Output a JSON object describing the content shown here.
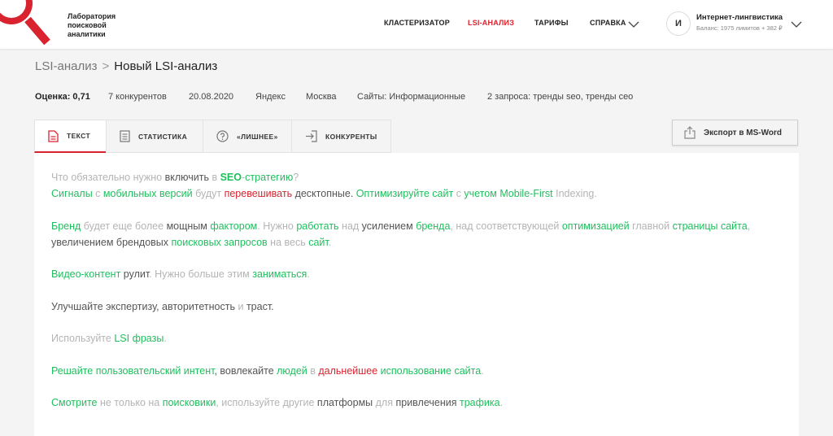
{
  "header": {
    "logo_line1": "Лаборатория",
    "logo_line2": "поисковой",
    "logo_line3": "аналитики",
    "nav": {
      "clusterizer": "КЛАСТЕРИЗАТОР",
      "lsi": "LSI-АНАЛИЗ",
      "tariffs": "ТАРИФЫ",
      "help": "СПРАВКА"
    },
    "user": {
      "initial": "И",
      "name": "Интернет-лингвистика",
      "balance": "Баланс: 1975 лимитов + 382 ₽"
    }
  },
  "breadcrumb": {
    "parent": "LSI-анализ",
    "separator": ">",
    "current": "Новый LSI-анализ"
  },
  "meta": {
    "score_label": "Оценка: 0,71",
    "competitors": "7 конкурентов",
    "date": "20.08.2020",
    "engine": "Яндекс",
    "city": "Москва",
    "sites": "Сайты: Информационные",
    "queries": "2 запроса: тренды seo, тренды сео"
  },
  "tabs": {
    "text": "ТЕКСТ",
    "stats": "СТАТИСТИКА",
    "extra": "«ЛИШНЕЕ»",
    "competitors": "КОНКУРЕНТЫ"
  },
  "export_label": "Экспорт в MS-Word",
  "colors": {
    "accent": "#d9232e",
    "green": "#1fbf5e",
    "gray": "#b4b4b4"
  },
  "text": {
    "p1": [
      {
        "t": "Что обязательно нужно ",
        "c": "gray"
      },
      {
        "t": "включить",
        "c": "dark"
      },
      {
        "t": " в ",
        "c": "gray"
      },
      {
        "t": "SEO",
        "c": "green",
        "b": true
      },
      {
        "t": "-",
        "c": "gray"
      },
      {
        "t": "стратегию",
        "c": "green"
      },
      {
        "t": "?",
        "c": "gray"
      }
    ],
    "p2": [
      {
        "t": "Сигналы",
        "c": "green"
      },
      {
        "t": " с ",
        "c": "gray"
      },
      {
        "t": "мобильных версий",
        "c": "green"
      },
      {
        "t": " будут ",
        "c": "gray"
      },
      {
        "t": "перевешивать",
        "c": "red"
      },
      {
        "t": " десктопные. ",
        "c": "dark"
      },
      {
        "t": "Оптимизируйте сайт",
        "c": "green"
      },
      {
        "t": " с ",
        "c": "gray"
      },
      {
        "t": "учетом",
        "c": "green"
      },
      {
        "t": " Mobile-First",
        "c": "green"
      },
      {
        "t": " Indexing.",
        "c": "gray"
      }
    ],
    "p3a": [
      {
        "t": "Бренд",
        "c": "green"
      },
      {
        "t": " будет еще более ",
        "c": "gray"
      },
      {
        "t": "мощным",
        "c": "dark"
      },
      {
        "t": " ",
        "c": "gray"
      },
      {
        "t": "фактором",
        "c": "green"
      },
      {
        "t": ". Нужно ",
        "c": "gray"
      },
      {
        "t": "работать",
        "c": "green"
      },
      {
        "t": " над ",
        "c": "gray"
      },
      {
        "t": "усилением",
        "c": "dark"
      },
      {
        "t": " ",
        "c": "gray"
      },
      {
        "t": "бренда",
        "c": "green"
      },
      {
        "t": ", над соответствующей ",
        "c": "gray"
      },
      {
        "t": "оптимизацией",
        "c": "green"
      },
      {
        "t": " главной ",
        "c": "gray"
      },
      {
        "t": "страницы сайта",
        "c": "green"
      },
      {
        "t": ",",
        "c": "gray"
      }
    ],
    "p3b": [
      {
        "t": "увеличением брендовых ",
        "c": "dark"
      },
      {
        "t": "поисковых запросов",
        "c": "green"
      },
      {
        "t": " на весь ",
        "c": "gray"
      },
      {
        "t": "сайт",
        "c": "green"
      },
      {
        "t": ".",
        "c": "gray"
      }
    ],
    "p4": [
      {
        "t": "Видео-контент",
        "c": "green"
      },
      {
        "t": " рулит",
        "c": "dark"
      },
      {
        "t": ". Нужно больше этим ",
        "c": "gray"
      },
      {
        "t": "заниматься",
        "c": "green"
      },
      {
        "t": ".",
        "c": "gray"
      }
    ],
    "p5": [
      {
        "t": "Улучшайте экспертизу, авторитетность",
        "c": "dark"
      },
      {
        "t": " и ",
        "c": "gray"
      },
      {
        "t": "траст.",
        "c": "dark"
      }
    ],
    "p6": [
      {
        "t": "Используйте ",
        "c": "gray"
      },
      {
        "t": "LSI фразы",
        "c": "green"
      },
      {
        "t": ".",
        "c": "gray"
      }
    ],
    "p7": [
      {
        "t": "Решайте пользовательский",
        "c": "green"
      },
      {
        "t": " ",
        "c": "gray"
      },
      {
        "t": "интент",
        "c": "green"
      },
      {
        "t": ", вовлекайте ",
        "c": "dark"
      },
      {
        "t": "людей",
        "c": "green"
      },
      {
        "t": " в ",
        "c": "gray"
      },
      {
        "t": "дальнейшее",
        "c": "red"
      },
      {
        "t": " ",
        "c": "gray"
      },
      {
        "t": "использование",
        "c": "green"
      },
      {
        "t": " ",
        "c": "gray"
      },
      {
        "t": "сайта",
        "c": "green"
      },
      {
        "t": ".",
        "c": "gray"
      }
    ],
    "p8": [
      {
        "t": "Смотрите",
        "c": "green"
      },
      {
        "t": " не только на ",
        "c": "gray"
      },
      {
        "t": "поисковики",
        "c": "green"
      },
      {
        "t": ", используйте другие ",
        "c": "gray"
      },
      {
        "t": "платформы",
        "c": "dark"
      },
      {
        "t": " для ",
        "c": "gray"
      },
      {
        "t": "привлечения",
        "c": "dark"
      },
      {
        "t": " ",
        "c": "gray"
      },
      {
        "t": "трафика",
        "c": "green"
      },
      {
        "t": ".",
        "c": "gray"
      }
    ]
  }
}
